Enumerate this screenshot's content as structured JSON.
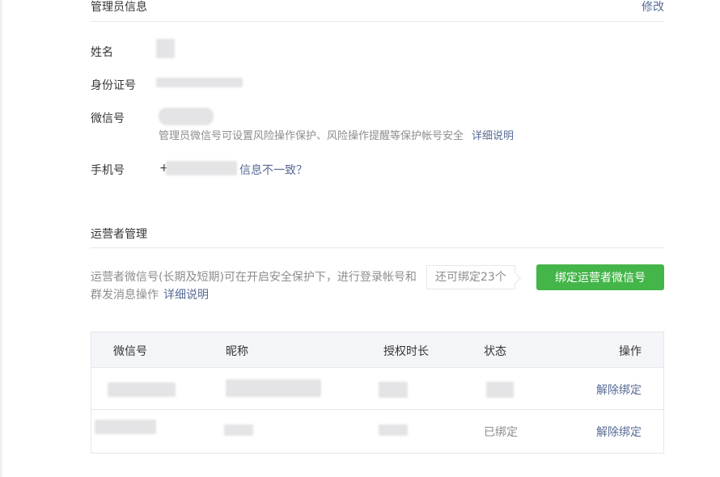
{
  "admin_info": {
    "title": "管理员信息",
    "edit_label": "修改",
    "name_label": "姓名",
    "id_label": "身份证号",
    "wechat_label": "微信号",
    "wechat_tip": "管理员微信号可设置风险操作保护、风险操作提醒等保护帐号安全",
    "wechat_tip_link": "详细说明",
    "phone_label": "手机号",
    "phone_prefix": "+",
    "phone_mismatch_link": "信息不一致？"
  },
  "operator": {
    "title": "运营者管理",
    "description": "运营者微信号(长期及短期)可在开启安全保护下，进行登录帐号和群发消息操作",
    "description_link": "详细说明",
    "remaining": "还可绑定23个",
    "bind_button": "绑定运营者微信号",
    "table": {
      "headers": [
        "微信号",
        "昵称",
        "授权时长",
        "状态",
        "操作"
      ],
      "rows": [
        {
          "status": "",
          "action": "解除绑定"
        },
        {
          "status": "已绑定",
          "action": "解除绑定"
        }
      ]
    }
  },
  "colors": {
    "accent_green": "#44b549",
    "link_blue": "#576b95",
    "muted_gray": "#8d8d8d"
  }
}
